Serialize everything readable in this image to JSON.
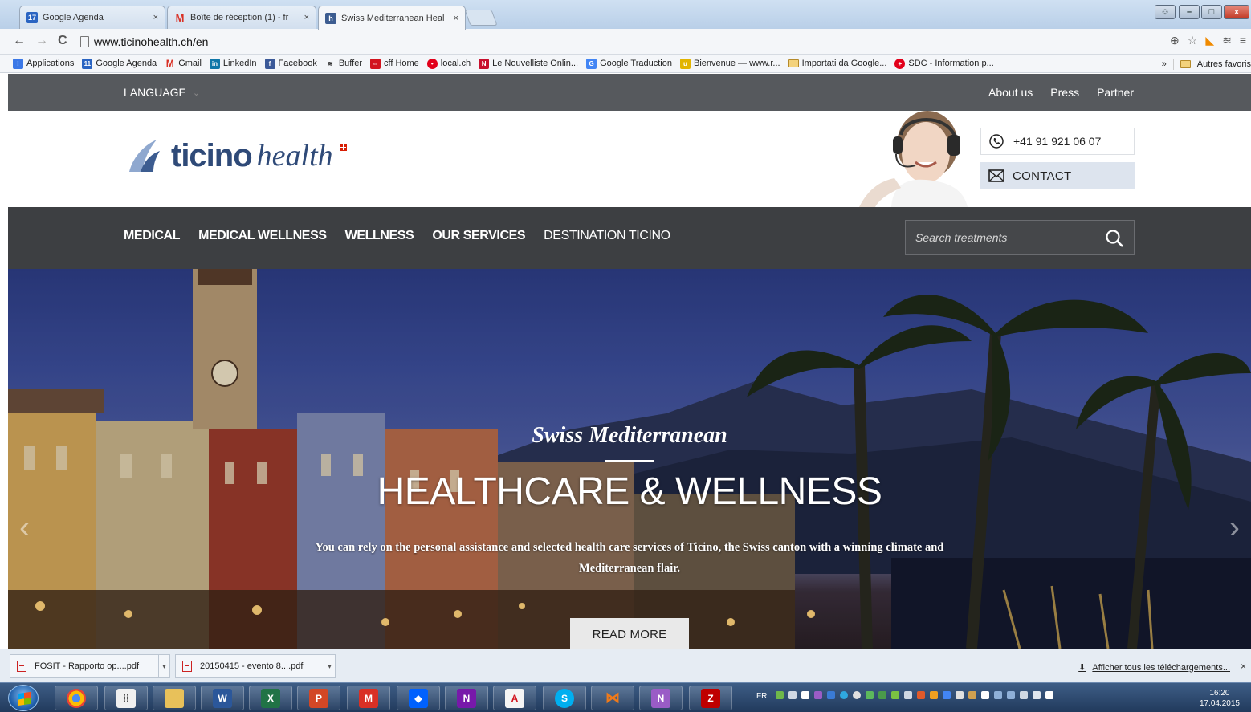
{
  "browser": {
    "tabs": [
      {
        "title": "Google Agenda",
        "icon": "calendar-17-icon"
      },
      {
        "title": "Boîte de réception (1) - fr",
        "icon": "gmail-icon"
      },
      {
        "title": "Swiss Mediterranean Heal",
        "icon": "ticinohealth-icon"
      }
    ],
    "url": "www.ticinohealth.ch/en",
    "bookmarks": [
      {
        "label": "Applications",
        "color": "#3b78e7"
      },
      {
        "label": "Google Agenda",
        "color": "#2a64c2"
      },
      {
        "label": "Gmail",
        "color": "#d93025"
      },
      {
        "label": "LinkedIn",
        "color": "#0e76a8"
      },
      {
        "label": "Facebook",
        "color": "#3b5998"
      },
      {
        "label": "Buffer",
        "color": "#222222"
      },
      {
        "label": "cff Home",
        "color": "#d2141e"
      },
      {
        "label": "local.ch",
        "color": "#e2001a"
      },
      {
        "label": "Le Nouvelliste Onlin...",
        "color": "#c8102e"
      },
      {
        "label": "Google Traduction",
        "color": "#4285f4"
      },
      {
        "label": "Bienvenue — www.r...",
        "color": "#e2b400"
      },
      {
        "label": "Importati da Google...",
        "color": "#e8c15a"
      },
      {
        "label": "SDC - Information p...",
        "color": "#e2001a"
      }
    ],
    "bookmarks_more": "»",
    "other_bookmarks": "Autres favoris"
  },
  "site": {
    "language_label": "LANGUAGE",
    "top_links": [
      "About us",
      "Press",
      "Partner"
    ],
    "logo": {
      "part1": "ticino",
      "part2": "health"
    },
    "phone": "+41 91 921 06 07",
    "contact_label": "CONTACT",
    "nav": [
      "MEDICAL",
      "MEDICAL WELLNESS",
      "WELLNESS",
      "OUR SERVICES",
      "DESTINATION TICINO"
    ],
    "search_placeholder": "Search treatments",
    "hero": {
      "subtitle": "Swiss Mediterranean",
      "title": "HEALTHCARE & WELLNESS",
      "text": "You can rely on the personal assistance and selected health care services of Ticino, the Swiss canton with a winning climate and Mediterranean flair.",
      "button": "READ MORE"
    },
    "colors": {
      "topbar": "#56595d",
      "nav": "#3d3f42",
      "brand": "#2f4a78",
      "contact_bg": "#dde4ee"
    }
  },
  "downloads": {
    "items": [
      "FOSIT - Rapporto op....pdf",
      "20150415 - evento 8....pdf"
    ],
    "show_all": "Afficher tous les téléchargements...",
    "close": "×"
  },
  "taskbar": {
    "apps": [
      "chrome",
      "apps",
      "explorer",
      "word",
      "excel",
      "powerpoint",
      "gmail",
      "dropbox",
      "onenote",
      "acrobat",
      "skype",
      "butterfly",
      "onenote-clip",
      "filezilla"
    ],
    "language": "FR",
    "time": "16:20",
    "date": "17.04.2015"
  }
}
